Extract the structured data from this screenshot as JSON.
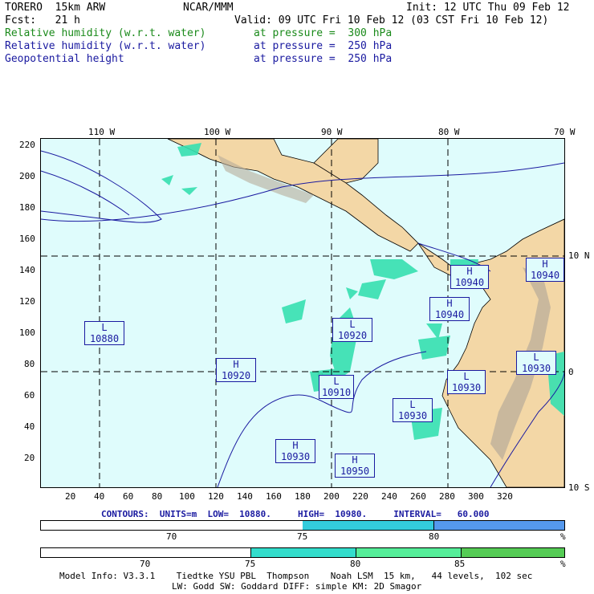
{
  "header": {
    "model": "TORERO  15km ARW",
    "center": "NCAR/MMM",
    "init": "Init: 12 UTC Thu 09 Feb 12",
    "fcst": "Fcst:   21 h",
    "valid": "Valid: 09 UTC Fri 10 Feb 12 (03 CST Fri 10 Feb 12)",
    "fields": [
      {
        "name": "Relative humidity (w.r.t. water)",
        "level": "at pressure =  300 hPa",
        "color": "#1a8a1a"
      },
      {
        "name": "Relative humidity (w.r.t. water)",
        "level": "at pressure =  250 hPa",
        "color": "#1a1aa0"
      },
      {
        "name": "Geopotential height",
        "level": "at pressure =  250 hPa",
        "color": "#1a1aa0"
      }
    ]
  },
  "map": {
    "top_labels": [
      "110 W",
      "100 W",
      "90 W",
      "80 W",
      "70 W"
    ],
    "right_labels": [
      "10 N",
      "0",
      "10 S"
    ],
    "y_ticks": [
      "220",
      "200",
      "180",
      "160",
      "140",
      "120",
      "100",
      "80",
      "60",
      "40",
      "20"
    ],
    "x_ticks": [
      "20",
      "40",
      "60",
      "80",
      "100",
      "120",
      "140",
      "160",
      "180",
      "200",
      "220",
      "240",
      "260",
      "280",
      "300",
      "320"
    ],
    "centers": [
      {
        "type": "L",
        "value": "10880"
      },
      {
        "type": "H",
        "value": "10920"
      },
      {
        "type": "L",
        "value": "10920"
      },
      {
        "type": "L",
        "value": "10910"
      },
      {
        "type": "H",
        "value": "10930"
      },
      {
        "type": "H",
        "value": "10950"
      },
      {
        "type": "L",
        "value": "10930"
      },
      {
        "type": "H",
        "value": "10940"
      },
      {
        "type": "H",
        "value": "10940"
      },
      {
        "type": "L",
        "value": "10930"
      },
      {
        "type": "H",
        "value": "10940"
      },
      {
        "type": "L",
        "value": "10930"
      }
    ],
    "colors": {
      "ocean": "#dffcfc",
      "land": "#f3d7a6",
      "rh_green": "#36e0b0",
      "contour": "#1a1aa0"
    }
  },
  "contours_line": "CONTOURS:  UNITS=m  LOW=  10880.     HIGH=  10980.     INTERVAL=   60.000",
  "bar1": {
    "labels": [
      "70",
      "75",
      "80"
    ],
    "unit": "%",
    "colors": [
      "#ffffff",
      "#33ccdd",
      "#5599ee"
    ]
  },
  "bar2": {
    "labels": [
      "70",
      "75",
      "80",
      "85"
    ],
    "unit": "%",
    "colors": [
      "#ffffff",
      "#33ddcc",
      "#55ee99",
      "#55cc55"
    ]
  },
  "footer": {
    "line1": "Model Info: V3.3.1    Tiedtke YSU PBL  Thompson    Noah LSM  15 km,   44 levels,  102 sec",
    "line2": "LW: Godd SW: Goddard DIFF: simple KM: 2D Smagor"
  }
}
